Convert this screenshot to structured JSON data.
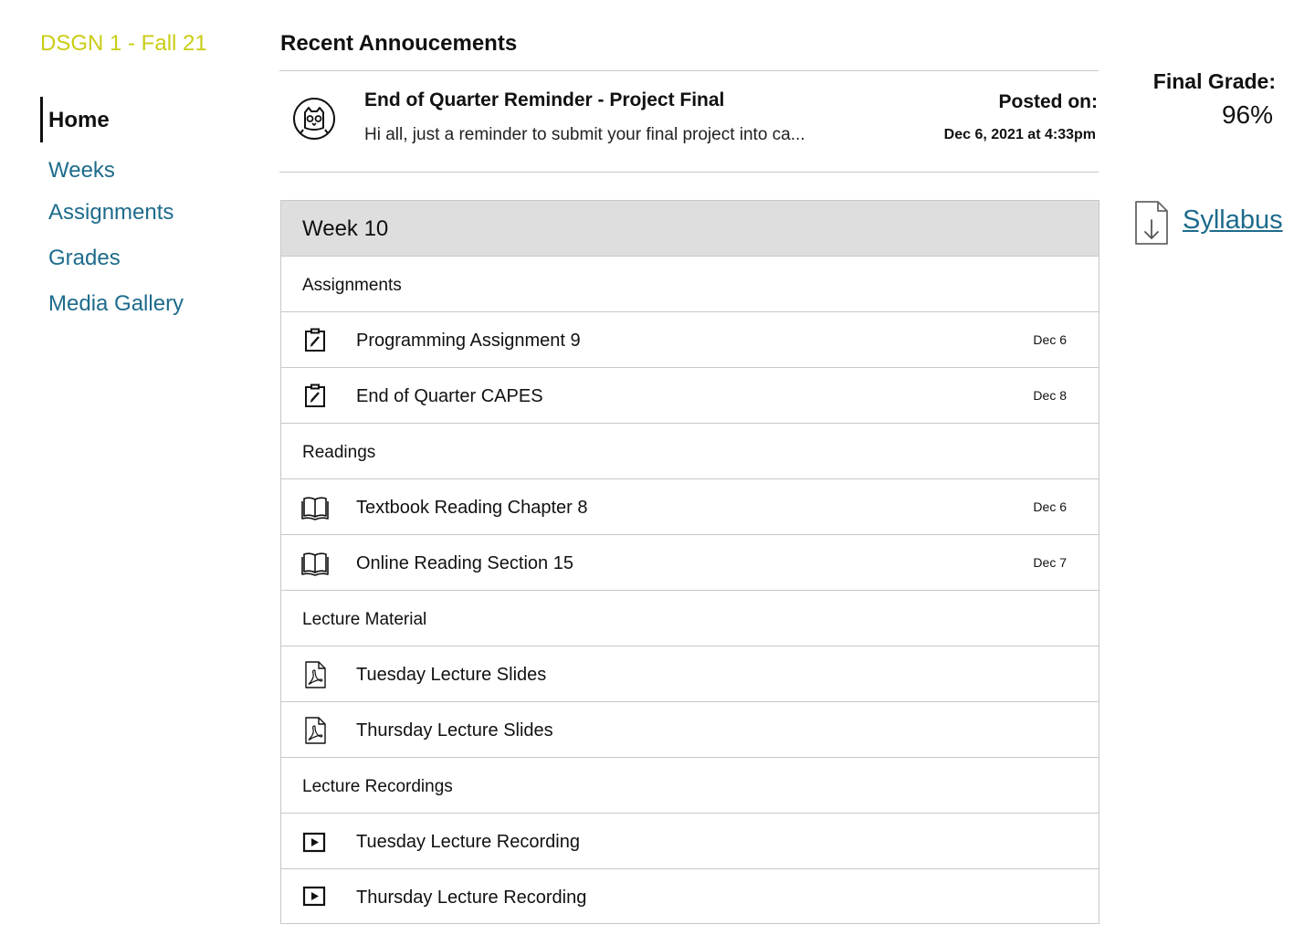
{
  "course": {
    "title": "DSGN 1 - Fall 21"
  },
  "nav": {
    "items": [
      {
        "label": "Home",
        "active": true
      },
      {
        "label": "Weeks"
      },
      {
        "label": "Assignments"
      },
      {
        "label": "Grades"
      },
      {
        "label": "Media Gallery"
      }
    ]
  },
  "announcements": {
    "heading": "Recent Annoucements",
    "item": {
      "title": "End of Quarter Reminder - Project Final",
      "preview": "Hi all, just a reminder to submit your final project into ca...",
      "posted_label": "Posted on:",
      "posted_date": "Dec 6, 2021 at 4:33pm",
      "avatar_icon": "owl-avatar-icon"
    }
  },
  "grade": {
    "label": "Final Grade:",
    "value": "96%"
  },
  "syllabus": {
    "label": "Syllabus",
    "icon": "file-download-icon"
  },
  "week": {
    "title": "Week 10",
    "sections": [
      {
        "label": "Assignments",
        "items": [
          {
            "label": "Programming Assignment 9",
            "due": "Dec 6",
            "icon": "assignment-edit-icon"
          },
          {
            "label": "End of Quarter CAPES",
            "due": "Dec 8",
            "icon": "assignment-edit-icon"
          }
        ]
      },
      {
        "label": "Readings",
        "items": [
          {
            "label": "Textbook Reading Chapter 8",
            "due": "Dec 6",
            "icon": "book-icon"
          },
          {
            "label": "Online Reading Section 15",
            "due": "Dec 7",
            "icon": "book-icon"
          }
        ]
      },
      {
        "label": "Lecture Material",
        "items": [
          {
            "label": "Tuesday Lecture Slides",
            "due": "",
            "icon": "pdf-file-icon"
          },
          {
            "label": "Thursday Lecture Slides",
            "due": "",
            "icon": "pdf-file-icon"
          }
        ]
      },
      {
        "label": "Lecture Recordings",
        "items": [
          {
            "label": "Tuesday Lecture Recording",
            "due": "",
            "icon": "video-play-icon"
          },
          {
            "label": "Thursday Lecture Recording",
            "due": "",
            "icon": "video-play-icon"
          }
        ]
      }
    ]
  },
  "colors": {
    "course_title": "#c9cd14",
    "link": "#1d6b8c",
    "header_bg": "#dedede",
    "divider": "#c8c8c8"
  }
}
